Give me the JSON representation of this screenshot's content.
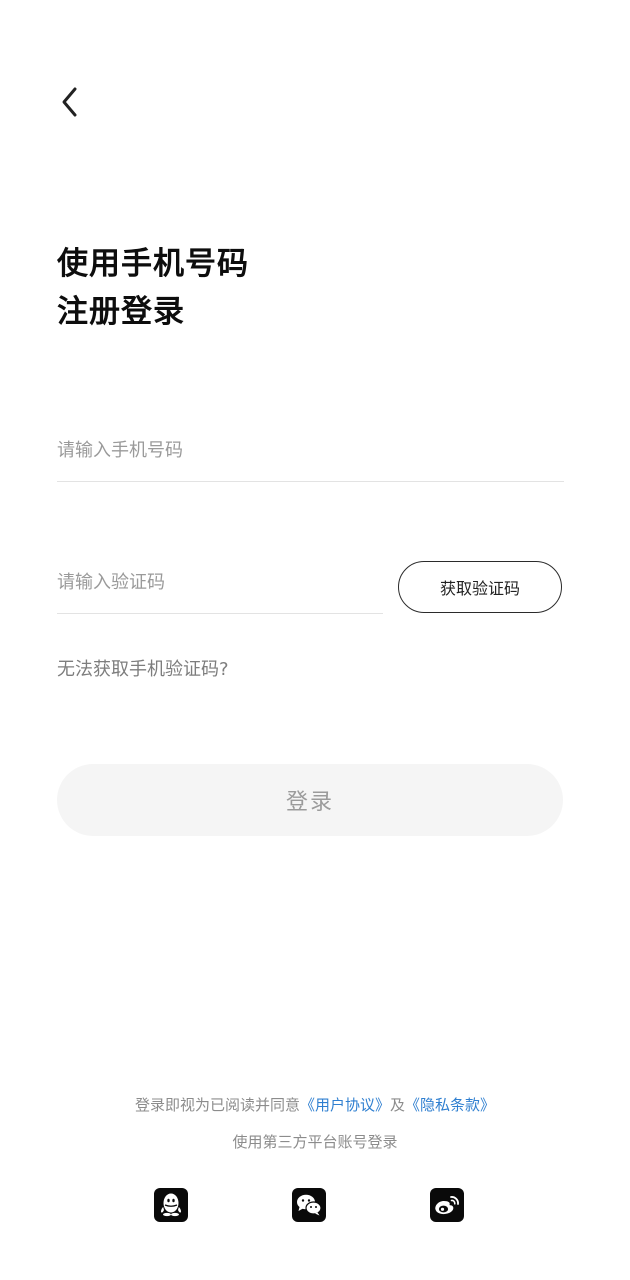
{
  "nav": {
    "back_icon": "chevron-left-icon"
  },
  "title": {
    "line1": "使用手机号码",
    "line2": "注册登录"
  },
  "phone": {
    "placeholder": "请输入手机号码",
    "value": ""
  },
  "code": {
    "placeholder": "请输入验证码",
    "value": "",
    "get_code_label": "获取验证码"
  },
  "help": {
    "cant_get_label": "无法获取手机验证码?"
  },
  "login": {
    "label": "登录"
  },
  "agreement": {
    "prefix": "登录即视为已阅读并同意",
    "user_agreement": "《用户协议》",
    "joiner": "及",
    "privacy_policy": "《隐私条款》"
  },
  "third_party": {
    "label": "使用第三方平台账号登录",
    "providers": [
      {
        "name": "qq",
        "icon": "qq-icon"
      },
      {
        "name": "wechat",
        "icon": "wechat-icon"
      },
      {
        "name": "weibo",
        "icon": "weibo-icon"
      }
    ]
  },
  "colors": {
    "link": "#2f7fd0",
    "login_bg": "#f5f5f5",
    "login_text": "#9b9b9b",
    "text_primary": "#0d0d0d",
    "text_secondary": "#8c8c8c"
  }
}
